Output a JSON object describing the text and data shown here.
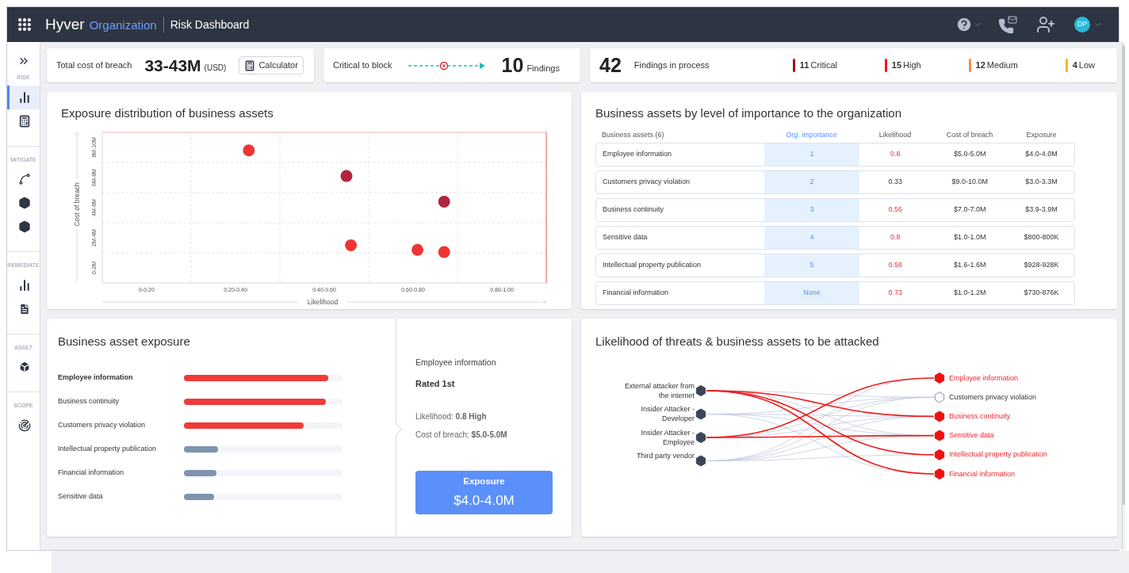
{
  "header": {
    "brand": "Hyver",
    "org": "Organization",
    "page": "Risk Dashboard",
    "avatar": "DP"
  },
  "sidebar": {
    "sections": [
      {
        "label": "RISK",
        "items": [
          {
            "kind": "chart",
            "selected": true
          },
          {
            "kind": "calculator",
            "selected": false
          }
        ]
      },
      {
        "label": "MITIGATE",
        "items": [
          {
            "kind": "route",
            "selected": false
          },
          {
            "kind": "hexagon",
            "selected": false
          },
          {
            "kind": "hexagon",
            "selected": false
          }
        ]
      },
      {
        "label": "REMEDIATE",
        "items": [
          {
            "kind": "chart",
            "selected": false
          },
          {
            "kind": "document",
            "selected": false
          }
        ]
      },
      {
        "label": "ASSET",
        "items": [
          {
            "kind": "cube",
            "selected": false
          }
        ]
      },
      {
        "label": "SCOPE",
        "items": [
          {
            "kind": "radar",
            "selected": false
          }
        ]
      }
    ]
  },
  "cost_card": {
    "label": "Total cost of breach",
    "value": "33-43M",
    "unit": "(USD)",
    "button": "Calculator"
  },
  "block_card": {
    "label": "Critical to block",
    "value": "10",
    "unit": "Findings"
  },
  "findings_card": {
    "value": "42",
    "label": "Findings in process",
    "severities": [
      {
        "count": "11",
        "label": "Critical",
        "color": "#a3141c"
      },
      {
        "count": "15",
        "label": "High",
        "color": "#f5141e"
      },
      {
        "count": "12",
        "label": "Medium",
        "color": "#ff8a3d"
      },
      {
        "count": "4",
        "label": "Low",
        "color": "#f5b41e"
      }
    ]
  },
  "exposure_chart": {
    "title": "Exposure distribution of business assets",
    "xlabel": "Likelihood",
    "ylabel": "Cost of breach",
    "x_ticks": [
      "0-0.20",
      "0.20-0.40",
      "0.40-0.60",
      "0.60-0.80",
      "0.80-1.00"
    ],
    "y_ticks": [
      "0-2M",
      "2M-4M",
      "4M-6M",
      "6M-8M",
      "8M-10M"
    ]
  },
  "assets_table": {
    "title": "Business assets by level of importance to the organization",
    "columns": [
      {
        "label": "Business assets (6)",
        "selected": false
      },
      {
        "label": "Org. importance",
        "selected": true
      },
      {
        "label": "Likelihood",
        "selected": false
      },
      {
        "label": "Cost of breach",
        "selected": false
      },
      {
        "label": "Exposure",
        "selected": false
      }
    ],
    "rows": [
      {
        "name": "Employee information",
        "importance": "1",
        "likelihood": "0.8",
        "high": true,
        "cost": "$5.0-5.0M",
        "exposure": "$4.0-4.0M"
      },
      {
        "name": "Customers privacy violation",
        "importance": "2",
        "likelihood": "0.33",
        "high": false,
        "cost": "$9.0-10.0M",
        "exposure": "$3.0-3.3M"
      },
      {
        "name": "Business continuity",
        "importance": "3",
        "likelihood": "0.56",
        "high": true,
        "cost": "$7.0-7.0M",
        "exposure": "$3.9-3.9M"
      },
      {
        "name": "Sensitive data",
        "importance": "4",
        "likelihood": "0.8",
        "high": true,
        "cost": "$1.0-1.0M",
        "exposure": "$800-800K"
      },
      {
        "name": "Intellectual property publication",
        "importance": "5",
        "likelihood": "0.58",
        "high": true,
        "cost": "$1.6-1.6M",
        "exposure": "$928-928K"
      },
      {
        "name": "Financial information",
        "importance": "None",
        "likelihood": "0.73",
        "high": true,
        "cost": "$1.0-1.2M",
        "exposure": "$730-876K"
      }
    ]
  },
  "asset_exposure": {
    "title": "Business asset exposure",
    "items": [
      {
        "name": "Employee information",
        "level": 0.91,
        "color": "#f03a3a",
        "selected": true
      },
      {
        "name": "Business continuity",
        "level": 0.895,
        "color": "#f03a3a",
        "selected": false
      },
      {
        "name": "Customers privacy violation",
        "level": 0.755,
        "color": "#f03a3a",
        "selected": false
      },
      {
        "name": "Intellectual property publication",
        "level": 0.215,
        "color": "#8094ad",
        "selected": false
      },
      {
        "name": "Financial information",
        "level": 0.205,
        "color": "#8094ad",
        "selected": false
      },
      {
        "name": "Sensitive data",
        "level": 0.19,
        "color": "#8094ad",
        "selected": false
      }
    ],
    "detail": {
      "name": "Employee information",
      "rating": "Rated 1st",
      "likelihood": "Likelihood: **0.8 High**",
      "cost": "Cost of breach: **$5.0-5.0M**",
      "exposure_label": "Exposure",
      "exposure_value": "$4.0-4.0M"
    }
  },
  "threats": {
    "title": "Likelihood of threats & business assets to be attacked",
    "sources": [
      {
        "label": "External attacker from the internet"
      },
      {
        "label": "Insider Attacker - Developer"
      },
      {
        "label": "Insider Attacker - Employee"
      },
      {
        "label": "Third party vendor"
      }
    ],
    "targets": [
      {
        "label": "Employee information",
        "at_risk": true
      },
      {
        "label": "Customers privacy violation",
        "at_risk": false
      },
      {
        "label": "Business continuity",
        "at_risk": true
      },
      {
        "label": "Sensitive data",
        "at_risk": true
      },
      {
        "label": "Intellectual property publication",
        "at_risk": true
      },
      {
        "label": "Financial information",
        "at_risk": true
      }
    ]
  }
}
